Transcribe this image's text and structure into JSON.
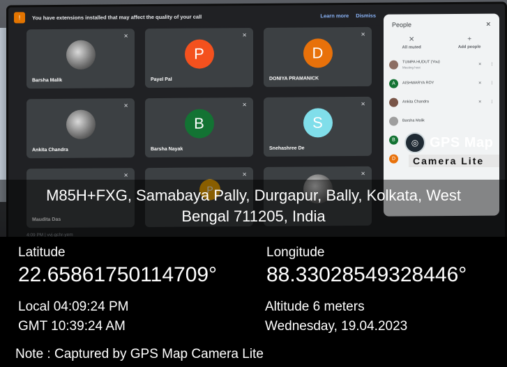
{
  "meet": {
    "warning": "You have extensions installed that may affect the quality of your call",
    "learn_more": "Learn more",
    "dismiss": "Dismiss",
    "tiles": [
      {
        "name": "Barsha Malik",
        "initial": "",
        "color": ""
      },
      {
        "name": "Payel Pal",
        "initial": "P",
        "color": "#f4511e"
      },
      {
        "name": "DONIYA PRAMANICK",
        "initial": "D",
        "color": "#e8710a"
      },
      {
        "name": "Ankita Chandra",
        "initial": "",
        "color": ""
      },
      {
        "name": "Barsha Nayak",
        "initial": "B",
        "color": "#137333"
      },
      {
        "name": "Snehashree De",
        "initial": "S",
        "color": "#80deea"
      },
      {
        "name": "Maudita Das",
        "initial": "",
        "color": ""
      },
      {
        "name": "",
        "initial": "P",
        "color": "#f9ab00"
      },
      {
        "name": "",
        "initial": "",
        "color": ""
      }
    ],
    "time_code": "4:09 PM  |  vvj-gchr-yem"
  },
  "people": {
    "title": "People",
    "all_muted": "All muted",
    "add_people": "Add people",
    "rows": [
      {
        "name": "TUMPA HUDUT (You)",
        "sub": "Meeting host",
        "initial": "",
        "color": "#8d6e63"
      },
      {
        "name": "AISHWARYA ROY",
        "sub": "",
        "initial": "A",
        "color": "#137333"
      },
      {
        "name": "Ankita Chandra",
        "sub": "",
        "initial": "",
        "color": "#795548"
      },
      {
        "name": "Barsha Malik",
        "sub": "",
        "initial": "",
        "color": "#9e9e9e"
      },
      {
        "name": "",
        "sub": "",
        "initial": "B",
        "color": "#137333"
      },
      {
        "name": "",
        "sub": "",
        "initial": "D",
        "color": "#e8710a"
      }
    ]
  },
  "overlay": {
    "brand": "GPS Map",
    "brand_sub": "Camera Lite",
    "address_line1": "M85H+FXG, Samabaya Pally, Durgapur, Bally, Kolkata, West",
    "address_line2": "Bengal 711205, India",
    "latitude_label": "Latitude",
    "latitude": "22.65861750114709°",
    "longitude_label": "Longitude",
    "longitude": "88.33028549328446°",
    "local_time": "Local 04:09:24 PM",
    "gmt_time": "GMT 10:39:24 AM",
    "altitude": "Altitude 6 meters",
    "date": "Wednesday, 19.04.2023",
    "note": "Note : Captured by GPS Map Camera Lite"
  }
}
